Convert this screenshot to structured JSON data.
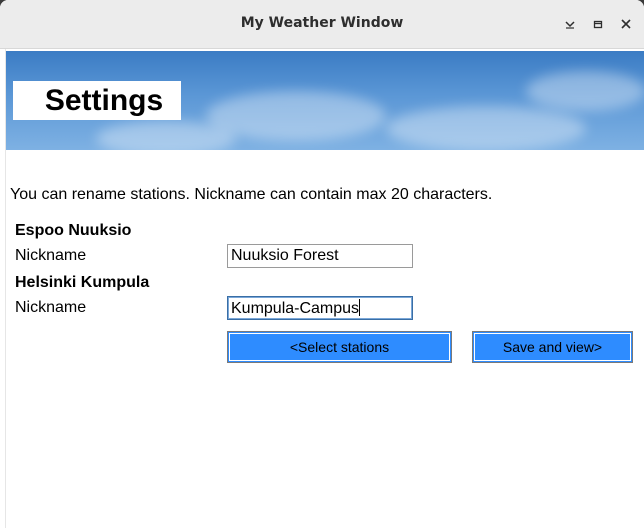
{
  "window": {
    "title": "My Weather Window",
    "controls": [
      "minimize-icon",
      "maximize-icon",
      "close-icon"
    ]
  },
  "banner": {
    "title": "Settings"
  },
  "info_text": "You can rename stations. Nickname can contain max 20 characters.",
  "stations": [
    {
      "name": "Espoo Nuuksio",
      "nickname_label": "Nickname",
      "nickname_value": "Nuuksio Forest"
    },
    {
      "name": "Helsinki Kumpula",
      "nickname_label": "Nickname",
      "nickname_value": "Kumpula-Campus"
    }
  ],
  "buttons": {
    "select_stations": "<Select stations",
    "save_and_view": "Save and view>"
  },
  "colors": {
    "button_bg": "#2e8cff",
    "banner_sky": "#5b97d6"
  }
}
